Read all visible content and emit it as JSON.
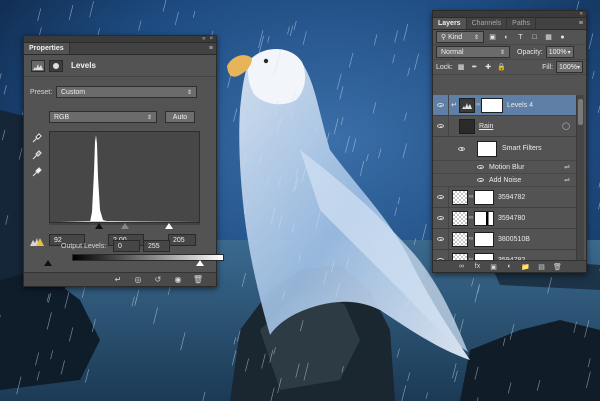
{
  "properties": {
    "tab_label": "Properties",
    "panel_title": "Levels",
    "preset_label": "Preset:",
    "preset_value": "Custom",
    "channel_value": "RGB",
    "auto_label": "Auto",
    "input_black": "92",
    "input_gamma": "2,00",
    "input_white": "205",
    "output_label": "Output Levels:",
    "output_black": "0",
    "output_white": "255"
  },
  "layers": {
    "tabs": [
      {
        "label": "Layers",
        "active": true
      },
      {
        "label": "Channels",
        "active": false
      },
      {
        "label": "Paths",
        "active": false
      }
    ],
    "filter_label": "Kind",
    "blend_mode": "Normal",
    "opacity_label": "Opacity:",
    "opacity_value": "100%",
    "lock_label": "Lock:",
    "fill_label": "Fill:",
    "fill_value": "100%",
    "items": [
      {
        "name": "Levels 4",
        "selected": true
      },
      {
        "name": "Rain"
      },
      {
        "name": "Smart Filters"
      },
      {
        "name": "Motion Blur"
      },
      {
        "name": "Add Noise"
      },
      {
        "name": "3594782"
      },
      {
        "name": "3594780"
      },
      {
        "name": "3800510B"
      },
      {
        "name": "3594782"
      }
    ]
  },
  "colors": {
    "panel_bg": "#535353",
    "selection": "#5f7fa7",
    "sky": "#1e4c82"
  }
}
